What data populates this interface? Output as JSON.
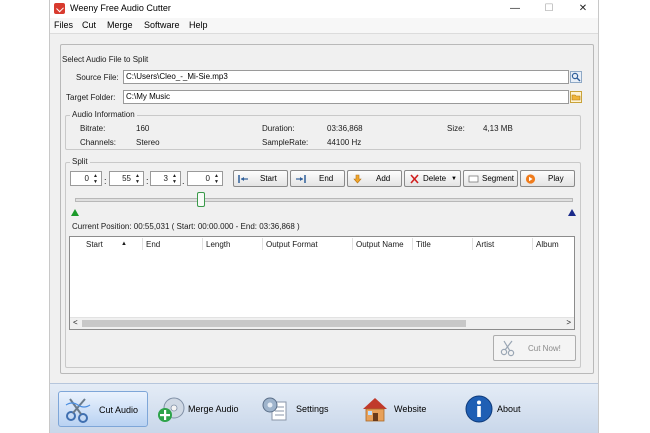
{
  "window": {
    "title": "Weeny Free Audio Cutter",
    "minimize_glyph": "—",
    "maximize_glyph": "☐",
    "close_glyph": "✕"
  },
  "menu": [
    "Files",
    "Cut",
    "Merge",
    "Software",
    "Help"
  ],
  "file_section": {
    "heading": "Select Audio File to Split",
    "source_label": "Source File:",
    "source_value": "C:\\Users\\Cleo_-_Mi-Sie.mp3",
    "target_label": "Target Folder:",
    "target_value": "C:\\My Music",
    "source_browse_icon": "search-icon",
    "target_browse_icon": "folder-icon"
  },
  "audio_info": {
    "title": "Audio Information",
    "bitrate_label": "Bitrate:",
    "bitrate_value": "160",
    "channels_label": "Channels:",
    "channels_value": "Stereo",
    "duration_label": "Duration:",
    "duration_value": "03:36,868",
    "samplerate_label": "SampleRate:",
    "samplerate_value": "44100 Hz",
    "size_label": "Size:",
    "size_value": "4,13 MB"
  },
  "split": {
    "title": "Split",
    "time_fields": [
      "0",
      "55",
      "3",
      "0"
    ],
    "separators": [
      ":",
      ":",
      "."
    ],
    "buttons": {
      "start": "Start",
      "end": "End",
      "add": "Add",
      "delete": "Delete",
      "segment": "Segment",
      "play": "Play"
    },
    "slider_position": 0.254,
    "current_position": "Current Position: 00:55,031 ( Start: 00:00.000 - End: 03:36,868 )",
    "columns": [
      "Start",
      "End",
      "Length",
      "Output Format",
      "Output Name",
      "Title",
      "Artist",
      "Album"
    ],
    "sort_glyph": "▲",
    "scroll_left": "<",
    "scroll_right": ">",
    "cut_now": "Cut Now!"
  },
  "toolbar": {
    "cut_audio": "Cut Audio",
    "merge_audio": "Merge Audio",
    "settings": "Settings",
    "website": "Website",
    "about": "About"
  },
  "colors": {
    "accent": "#3e7fd1",
    "start_marker": "#1b9a2a",
    "end_marker": "#1a2a8a",
    "delete_red": "#d01f1f",
    "play_orange": "#f07c1c"
  }
}
